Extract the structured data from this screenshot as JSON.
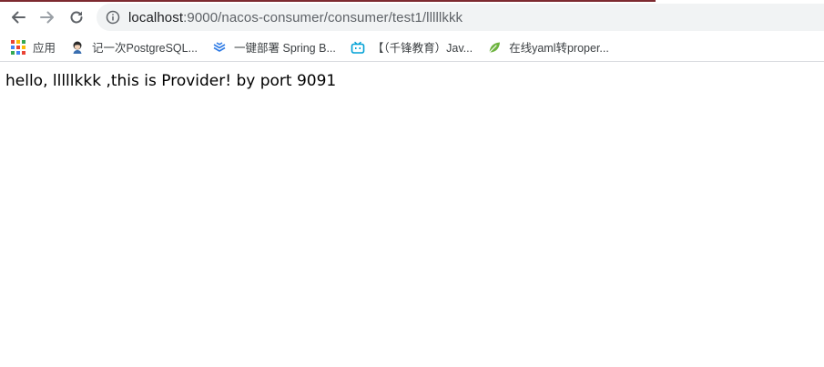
{
  "browser": {
    "url_host": "localhost",
    "url_path": ":9000/nacos-consumer/consumer/test1/lllllkkk",
    "accent_color": "#7d2a30",
    "omnibox_bg": "#f1f3f4"
  },
  "toolbar": {
    "back_icon": "arrow-left-icon",
    "forward_icon": "arrow-right-icon",
    "reload_icon": "reload-icon",
    "site_info_icon": "info-icon"
  },
  "bookmarks": [
    {
      "label": "应用",
      "icon": "apps-grid-icon"
    },
    {
      "label": "记一次PostgreSQL...",
      "icon": "avatar-icon"
    },
    {
      "label": "一键部署 Spring B...",
      "icon": "layers-icon"
    },
    {
      "label": "【（千锋教育）Jav...",
      "icon": "bilibili-tv-icon"
    },
    {
      "label": "在线yaml转proper...",
      "icon": "leaf-icon"
    }
  ],
  "page": {
    "text": "hello, lllllkkk ,this is Provider! by port 9091"
  }
}
